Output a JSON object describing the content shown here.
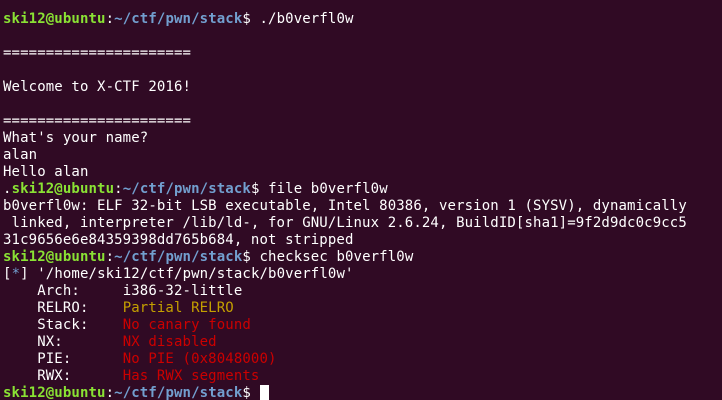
{
  "prompt": {
    "user_host": "ski12@ubuntu",
    "sep": ":",
    "path": "~/ctf/pwn/stack",
    "symbol": "$ "
  },
  "program": {
    "command": "./b0verfl0w",
    "blank": "",
    "divider": "======================",
    "welcome": "Welcome to X-CTF 2016!",
    "question": "What's your name?",
    "answer": "alan",
    "greeting": "Hello alan"
  },
  "file_cmd": {
    "leading_char": ".",
    "command": "file b0verfl0w",
    "output": [
      "b0verfl0w: ELF 32-bit LSB executable, Intel 80386, version 1 (SYSV), dynamically",
      " linked, interpreter /lib/ld-, for GNU/Linux 2.6.24, BuildID[sha1]=9f2d9dc0c9cc5",
      "31c9656e6e84359398dd765b684, not stripped"
    ]
  },
  "checksec_cmd": {
    "command": "checksec b0verfl0w",
    "status_open": "[",
    "status_star": "*",
    "status_close": "]",
    "file_path": " '/home/ski12/ctf/pwn/stack/b0verfl0w'",
    "rows": [
      {
        "label": "    Arch:     ",
        "value": "i386-32-little",
        "color": "#ffffff"
      },
      {
        "label": "    RELRO:    ",
        "value": "Partial RELRO",
        "color": "#c4a000"
      },
      {
        "label": "    Stack:    ",
        "value": "No canary found",
        "color": "#cc0000"
      },
      {
        "label": "    NX:       ",
        "value": "NX disabled",
        "color": "#cc0000"
      },
      {
        "label": "    PIE:      ",
        "value": "No PIE (0x8048000)",
        "color": "#cc0000"
      },
      {
        "label": "    RWX:      ",
        "value": "Has RWX segments",
        "color": "#cc0000"
      }
    ]
  },
  "colors": {
    "background": "#300a24",
    "prompt_user": "#8ae234",
    "prompt_path": "#729fcf",
    "warning": "#c4a000",
    "danger": "#cc0000"
  }
}
